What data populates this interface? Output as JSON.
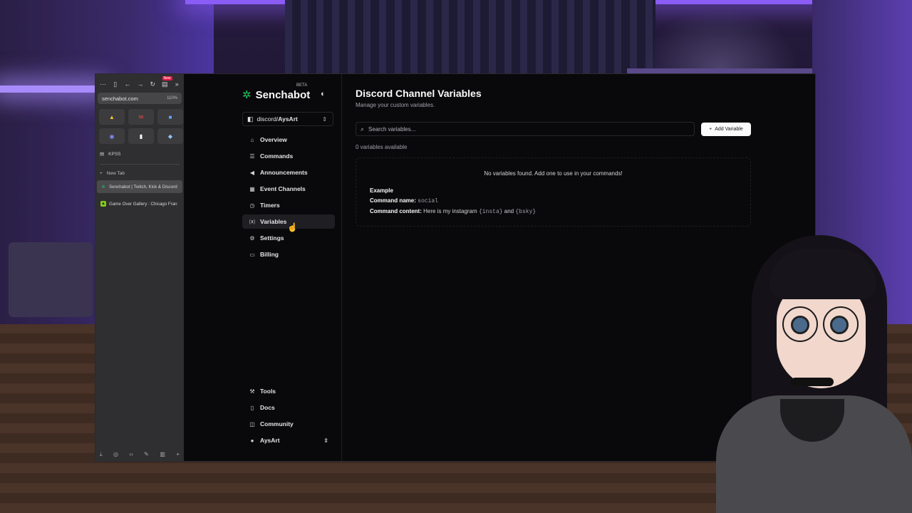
{
  "browser": {
    "url": "senchabot.com",
    "zoom": "110%",
    "news_badge": "New",
    "folder_label": "KPSS",
    "new_tab_label": "New Tab",
    "tabs": [
      {
        "title": "Senchabot | Twitch, Kick & Discord",
        "active": true
      },
      {
        "title": "Game Over Gallery : Chicago Fran",
        "active": false
      }
    ]
  },
  "app": {
    "brand": "Senchabot",
    "beta_label": "BETA",
    "channel": {
      "platform": "discord/",
      "name": "AysArt"
    },
    "nav": [
      {
        "label": "Overview",
        "icon": "home-icon",
        "active": false
      },
      {
        "label": "Commands",
        "icon": "list-icon",
        "active": false
      },
      {
        "label": "Announcements",
        "icon": "megaphone-icon",
        "active": false
      },
      {
        "label": "Event Channels",
        "icon": "calendar-icon",
        "active": false
      },
      {
        "label": "Timers",
        "icon": "timer-icon",
        "active": false
      },
      {
        "label": "Variables",
        "icon": "variable-icon",
        "active": true
      },
      {
        "label": "Settings",
        "icon": "gear-icon",
        "active": false
      },
      {
        "label": "Billing",
        "icon": "card-icon",
        "active": false
      }
    ],
    "bottom_nav": [
      {
        "label": "Tools",
        "icon": "wrench-icon"
      },
      {
        "label": "Docs",
        "icon": "document-icon"
      },
      {
        "label": "Community",
        "icon": "chat-icon"
      }
    ],
    "user": "AysArt"
  },
  "page": {
    "title": "Discord Channel Variables",
    "subtitle": "Manage your custom variables.",
    "search_placeholder": "Search variables...",
    "add_button": "Add Variable",
    "count_text": "0 variables available",
    "empty_message": "No variables found. Add one to use in your commands!",
    "example": {
      "heading": "Example",
      "name_label": "Command name:",
      "name_value": "social",
      "content_label": "Command content:",
      "content_prefix": "Here is my instagram",
      "var1": "{insta}",
      "joiner": "and",
      "var2": "{bsky}"
    }
  }
}
